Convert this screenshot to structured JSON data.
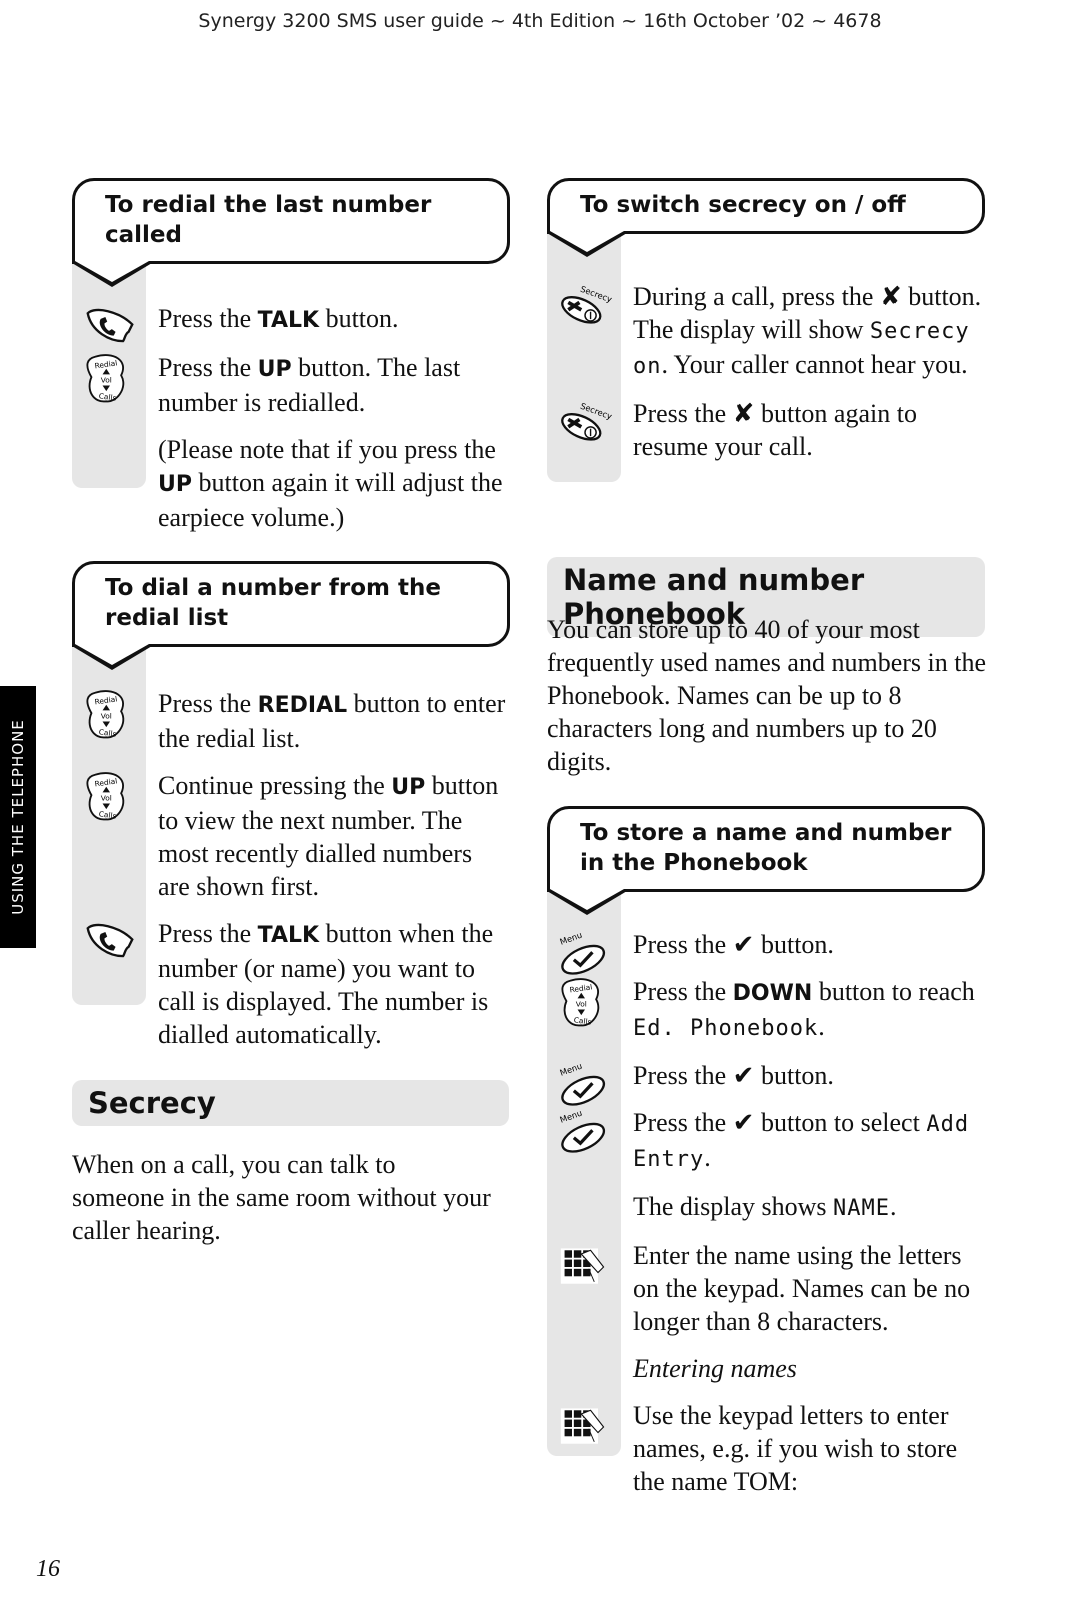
{
  "header": {
    "text": "Synergy 3200 SMS user guide ~ 4th Edition ~ 16th October ’02 ~ 4678"
  },
  "side_tab": {
    "label": "USING THE TELEPHONE"
  },
  "page_number": "16",
  "redial_last": {
    "title": "To redial the last number called",
    "steps": [
      {
        "icon": "talk-button-icon",
        "pre": "Press the ",
        "bold": "TALK",
        "post": " button."
      },
      {
        "icon": "redial-vol-calls-icon",
        "pre": "Press the ",
        "bold": "UP",
        "post": " button. The last number is redialled."
      },
      {
        "icon": "",
        "pre": "(Please note that if you press the ",
        "bold": "UP",
        "post": " button again it will adjust the earpiece volume.)"
      }
    ]
  },
  "redial_list": {
    "title": "To dial a number from the redial list",
    "steps": [
      {
        "icon": "redial-vol-calls-icon",
        "pre": "Press the ",
        "bold": "REDIAL",
        "post": " button to enter the redial list."
      },
      {
        "icon": "redial-vol-calls-icon",
        "pre": "Continue pressing the ",
        "bold": "UP",
        "post": " button to view the next number. The most recently dialled numbers are shown first."
      },
      {
        "icon": "talk-button-icon",
        "pre": "Press the ",
        "bold": "TALK",
        "post": " button when the number (or name) you want to call is displayed. The number is dialled automatically."
      }
    ]
  },
  "secrecy": {
    "title": "Secrecy",
    "body": "When on a call, you can talk to someone in the same room without your caller hearing."
  },
  "secrecy_switch": {
    "title": "To switch secrecy on / off",
    "steps": [
      {
        "icon": "secrecy-button-icon",
        "pre": "During a call, press the ",
        "glyph": "✘",
        "mid": " button. The display will show ",
        "lcd": "Secrecy on",
        "post": ". Your caller cannot hear you."
      },
      {
        "icon": "secrecy-button-icon",
        "pre": "Press the ",
        "glyph": "✘",
        "post": " button again to resume your call."
      }
    ],
    "icon_label": "Secrecy"
  },
  "phonebook": {
    "title": "Name and number Phonebook",
    "intro": "You can store up to 40 of your most frequently used names and numbers in the Phonebook. Names can be up to 8 characters long and numbers up to 20 digits."
  },
  "store_entry": {
    "title": "To store a name and number in the Phonebook",
    "icon_labels": {
      "menu": "Menu",
      "redial": "Redial",
      "vol": "Vol",
      "calls": "Calls"
    },
    "steps": [
      {
        "icon": "menu-ok-button-icon",
        "pre": "Press the ",
        "glyph": "✔",
        "post": " button."
      },
      {
        "icon": "redial-vol-calls-icon",
        "pre": "Press the ",
        "bold": "DOWN",
        "mid": " button to reach ",
        "lcd": "Ed. Phonebook",
        "post": "."
      },
      {
        "icon": "menu-ok-button-icon",
        "pre": "Press the ",
        "glyph": "✔",
        "post": " button."
      },
      {
        "icon": "menu-ok-button-icon",
        "pre": "Press the ",
        "glyph": "✔",
        "mid": " button to select ",
        "lcd": "Add Entry",
        "post": "."
      },
      {
        "icon": "",
        "pre": "The display shows ",
        "lcd": "NAME",
        "post": "."
      },
      {
        "icon": "keypad-icon",
        "pre": "Enter the name using the letters on the keypad. Names can be no longer than 8 characters."
      },
      {
        "icon": "",
        "italic": "Entering names"
      },
      {
        "icon": "keypad-icon",
        "pre": "Use the keypad letters to enter names, e.g. if you wish to store the name TOM:"
      }
    ]
  }
}
